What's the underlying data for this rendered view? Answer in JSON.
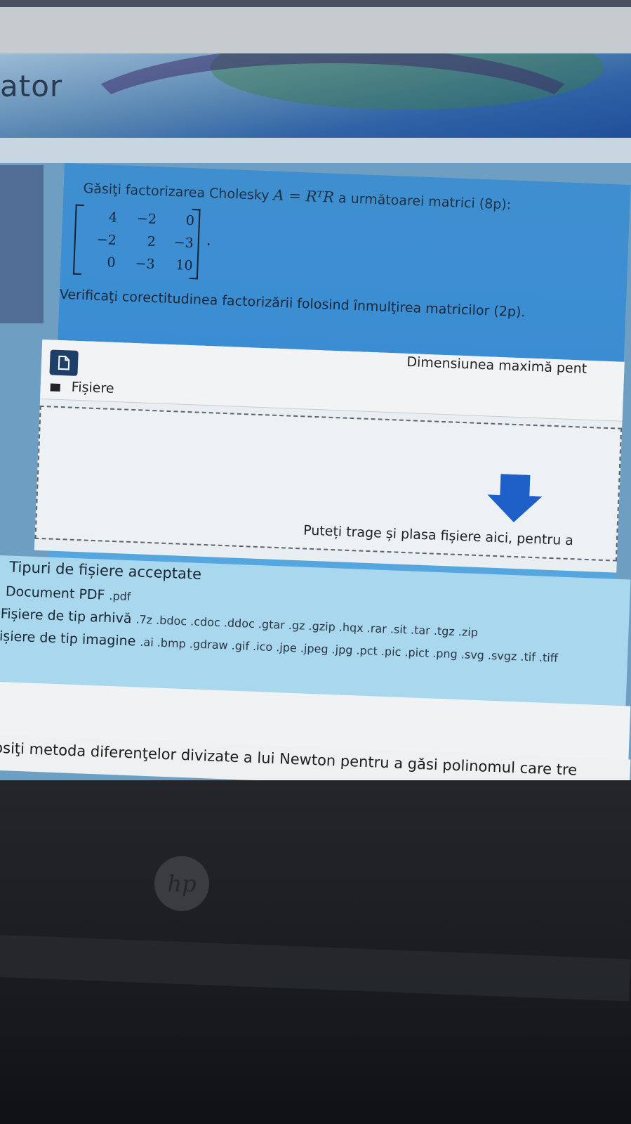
{
  "site": {
    "title_fragment": "ator"
  },
  "question": {
    "line1_prefix": "Găsiţi factorizarea Cholesky",
    "formula": "A = RᵀR",
    "line1_suffix": "a următoarei matrici (8p):",
    "matrix": [
      [
        "4",
        "−2",
        "0"
      ],
      [
        "−2",
        "2",
        "−3"
      ],
      [
        "0",
        "−3",
        "10"
      ]
    ],
    "matrix_end": ".",
    "line2": "Verificaţi corectitudinea factorizării folosind înmulţirea matricilor (2p)."
  },
  "upload": {
    "max_size_label": "Dimensiunea maximă pent",
    "files_label": "Fișiere",
    "drop_text": "Puteți trage și plasa fișiere aici, pentru a",
    "file_icon": "file-icon",
    "folder_icon": "folder-icon",
    "arrow_icon": "download-arrow-icon",
    "arrow_color": "#1f5fc8"
  },
  "accepted_types": {
    "title": "Tipuri de fișiere acceptate",
    "groups": [
      {
        "name": "Document PDF",
        "extensions": ".pdf"
      },
      {
        "name": "Fișiere de tip arhivă",
        "extensions": ".7z .bdoc .cdoc .ddoc .gtar .gz .gzip .hqx .rar .sit .tar .tgz .zip"
      },
      {
        "name": "Fișiere de tip imagine",
        "extensions": ".ai .bmp .gdraw .gif .ico .jpe .jpeg .jpg .pct .pic .pict .png .svg .svgz .tif .tiff"
      }
    ]
  },
  "next_question": {
    "text": "osiţi metoda diferenţelor divizate a lui Newton pentru a găsi polinomul care tre"
  },
  "device": {
    "logo": "hp"
  }
}
